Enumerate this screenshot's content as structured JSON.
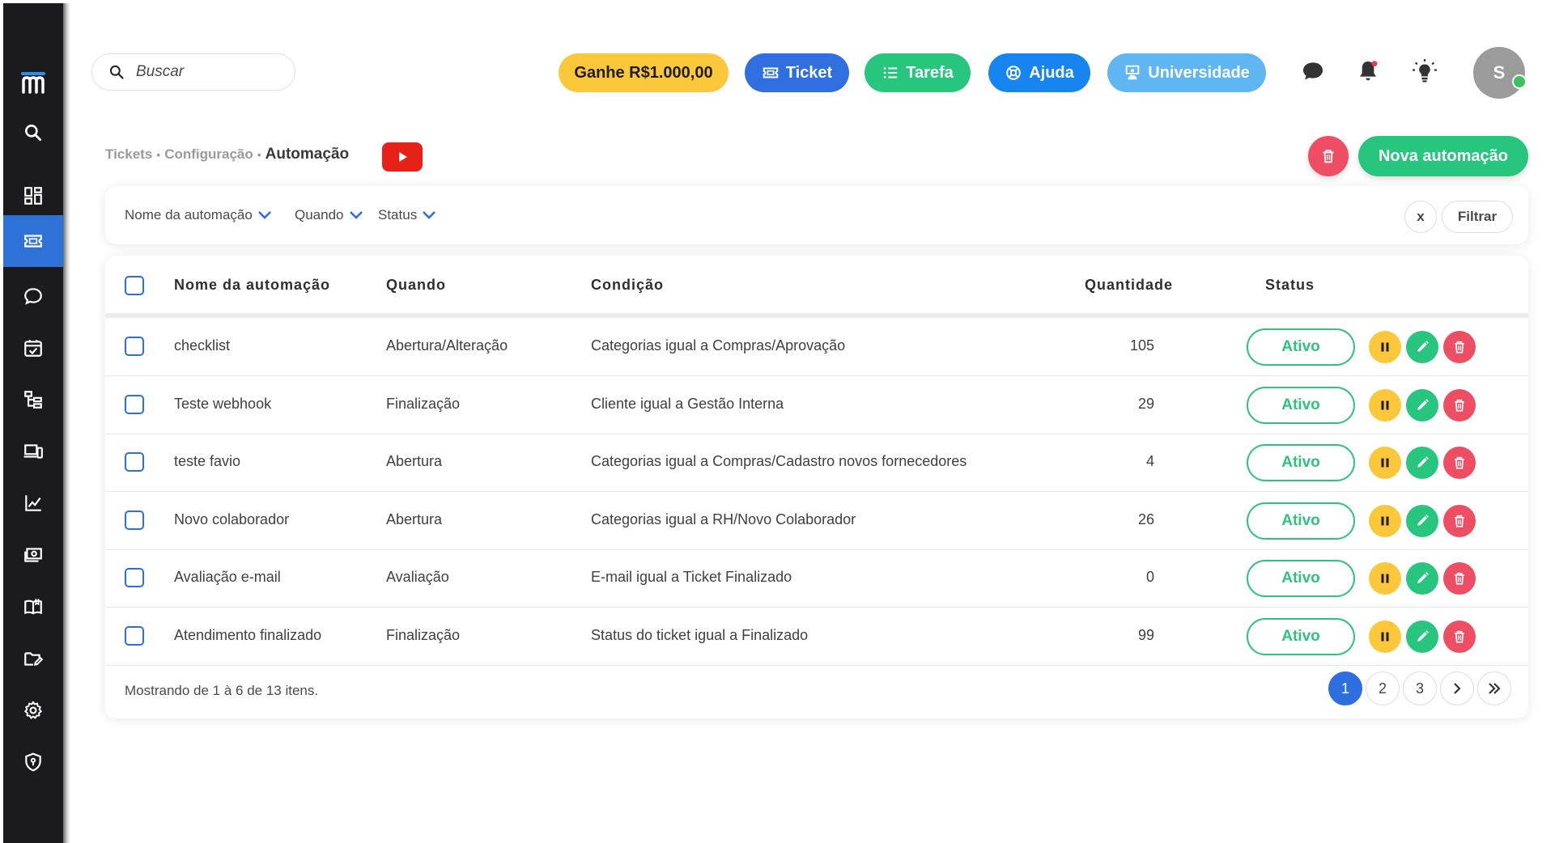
{
  "search": {
    "placeholder": "Buscar"
  },
  "topbar": {
    "earn_label": "Ganhe R$1.000,00",
    "ticket_label": "Ticket",
    "tarefa_label": "Tarefa",
    "ajuda_label": "Ajuda",
    "universidade_label": "Universidade",
    "avatar_initial": "S"
  },
  "breadcrumb": {
    "items": [
      "Tickets",
      "Configuração"
    ],
    "current": "Automação"
  },
  "actions": {
    "new_label": "Nova automação"
  },
  "filters": {
    "items": [
      "Nome da automação",
      "Quando",
      "Status"
    ],
    "clear_label": "x",
    "apply_label": "Filtrar"
  },
  "table": {
    "columns": [
      "Nome da automação",
      "Quando",
      "Condição",
      "Quantidade",
      "Status"
    ],
    "rows": [
      {
        "name": "checklist",
        "when": "Abertura/Alteração",
        "condition": "Categorias igual a Compras/Aprovação",
        "qty": "105",
        "status": "Ativo"
      },
      {
        "name": "Teste webhook",
        "when": "Finalização",
        "condition": "Cliente igual a Gestão Interna",
        "qty": "29",
        "status": "Ativo"
      },
      {
        "name": "teste favio",
        "when": "Abertura",
        "condition": "Categorias igual a Compras/Cadastro novos fornecedores",
        "qty": "4",
        "status": "Ativo"
      },
      {
        "name": "Novo colaborador",
        "when": "Abertura",
        "condition": "Categorias igual a RH/Novo Colaborador",
        "qty": "26",
        "status": "Ativo"
      },
      {
        "name": "Avaliação e-mail",
        "when": "Avaliação",
        "condition": "E-mail igual a Ticket Finalizado",
        "qty": "0",
        "status": "Ativo"
      },
      {
        "name": "Atendimento finalizado",
        "when": "Finalização",
        "condition": "Status do ticket igual a Finalizado",
        "qty": "99",
        "status": "Ativo"
      }
    ],
    "footer": "Mostrando de 1 à 6 de 13 itens.",
    "pages": [
      "1",
      "2",
      "3"
    ]
  },
  "colors": {
    "primary": "#2e6fe0",
    "success": "#27c57d",
    "warning": "#fcc83b",
    "danger": "#ee4e63",
    "sidebar": "#1b1b1d"
  },
  "icons": {
    "sidebar": [
      "search-icon",
      "dashboard-icon",
      "ticket-icon",
      "chat-icon",
      "calendar-check-icon",
      "org-tree-icon",
      "devices-icon",
      "chart-line-icon",
      "money-icon",
      "book-icon",
      "folder-edit-icon",
      "gear-icon",
      "shield-icon"
    ]
  }
}
